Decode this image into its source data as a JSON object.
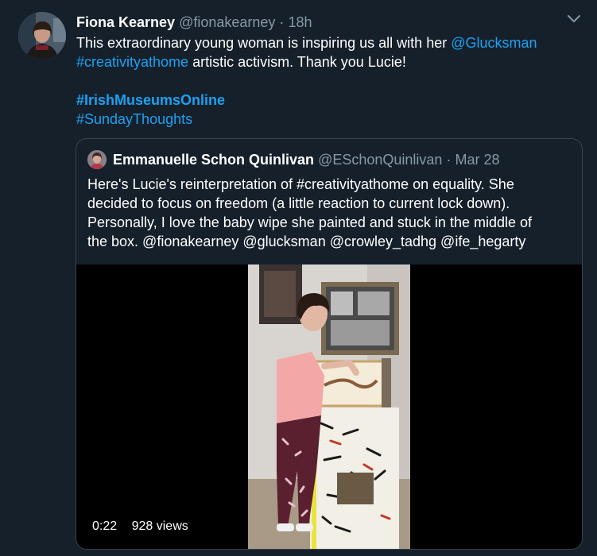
{
  "tweet": {
    "author_name": "Fiona Kearney",
    "author_handle": "@fionakearney",
    "separator": "·",
    "time": "18h",
    "text_part1": "This extraordinary young woman is inspiring us all with her ",
    "mention_glucksman": "@Glucksman",
    "hashtag_creativity": "#creativityathome",
    "text_part2": " artistic activism. Thank you Lucie!",
    "hashtag_irish": "#IrishMuseumsOnline",
    "hashtag_sunday": "#SundayThoughts"
  },
  "quote": {
    "author_name": "Emmanuelle Schon Quinlivan",
    "author_handle": "@ESchonQuinlivan",
    "separator": "·",
    "date": "Mar 28",
    "lines": [
      "Here's Lucie's reinterpretation of #creativityathome on equality. She",
      "decided to focus on freedom (a little reaction to current lock down).",
      "Personally, I love the baby wipe she painted and stuck in the middle of",
      "the box. @fionakearney @glucksman @crowley_tadhg @ife_hegarty"
    ]
  },
  "video": {
    "duration": "0:22",
    "views": "928 views"
  },
  "icons": {
    "caret": "chevron-down-icon"
  }
}
